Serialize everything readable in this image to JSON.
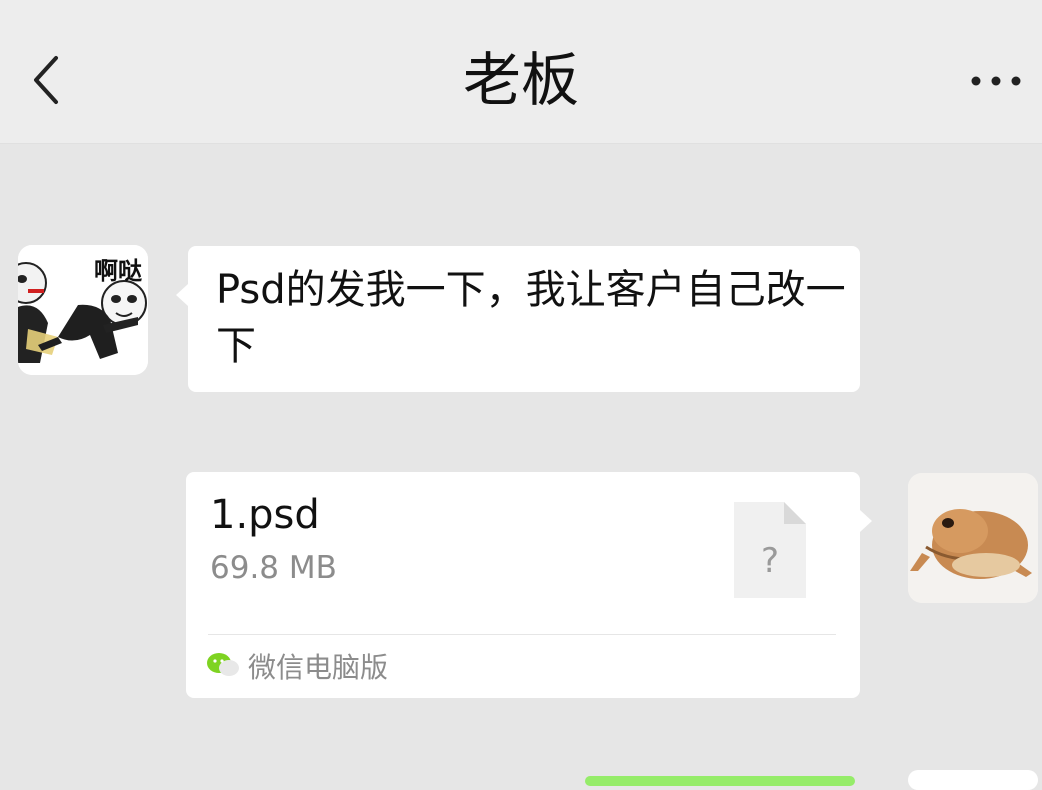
{
  "header": {
    "title": "老板",
    "back_icon": "chevron-left-icon",
    "more_icon": "more-dots-icon"
  },
  "messages": [
    {
      "side": "left",
      "avatar_caption": "啊哒",
      "text": "Psd的发我一下，我让客户自己改一下"
    },
    {
      "side": "right",
      "file": {
        "name": "1.psd",
        "size": "69.8 MB",
        "source": "微信电脑版",
        "icon_glyph": "?"
      }
    }
  ],
  "colors": {
    "chat_bg": "#e6e6e6",
    "header_bg": "#ededed",
    "bubble_bg": "#ffffff",
    "sent_green": "#95ec69"
  }
}
